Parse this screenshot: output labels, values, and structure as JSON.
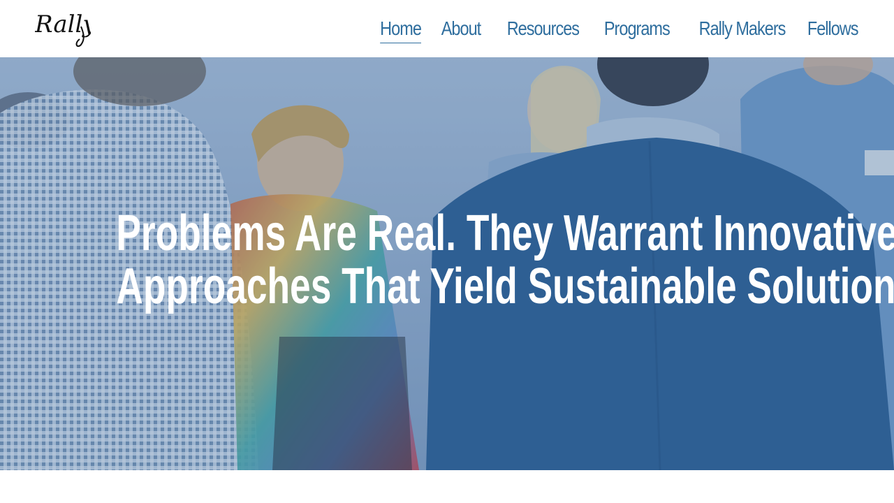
{
  "brand": {
    "logo_text": "Rally"
  },
  "nav": {
    "items": [
      {
        "label": "Home",
        "active": true
      },
      {
        "label": "About",
        "active": false
      },
      {
        "label": "Resources",
        "active": false
      },
      {
        "label": "Programs",
        "active": false
      },
      {
        "label": "Rally Makers",
        "active": false
      },
      {
        "label": "Fellows",
        "active": false
      }
    ]
  },
  "hero": {
    "headline_line1": "Problems Are Real. They Warrant Innovative",
    "headline_line2": "Approaches That Yield Sustainable Solutions."
  },
  "colors": {
    "nav_link": "#2f6e9e",
    "hero_overlay": "#2d5f96",
    "headline_text": "#ffffff"
  }
}
